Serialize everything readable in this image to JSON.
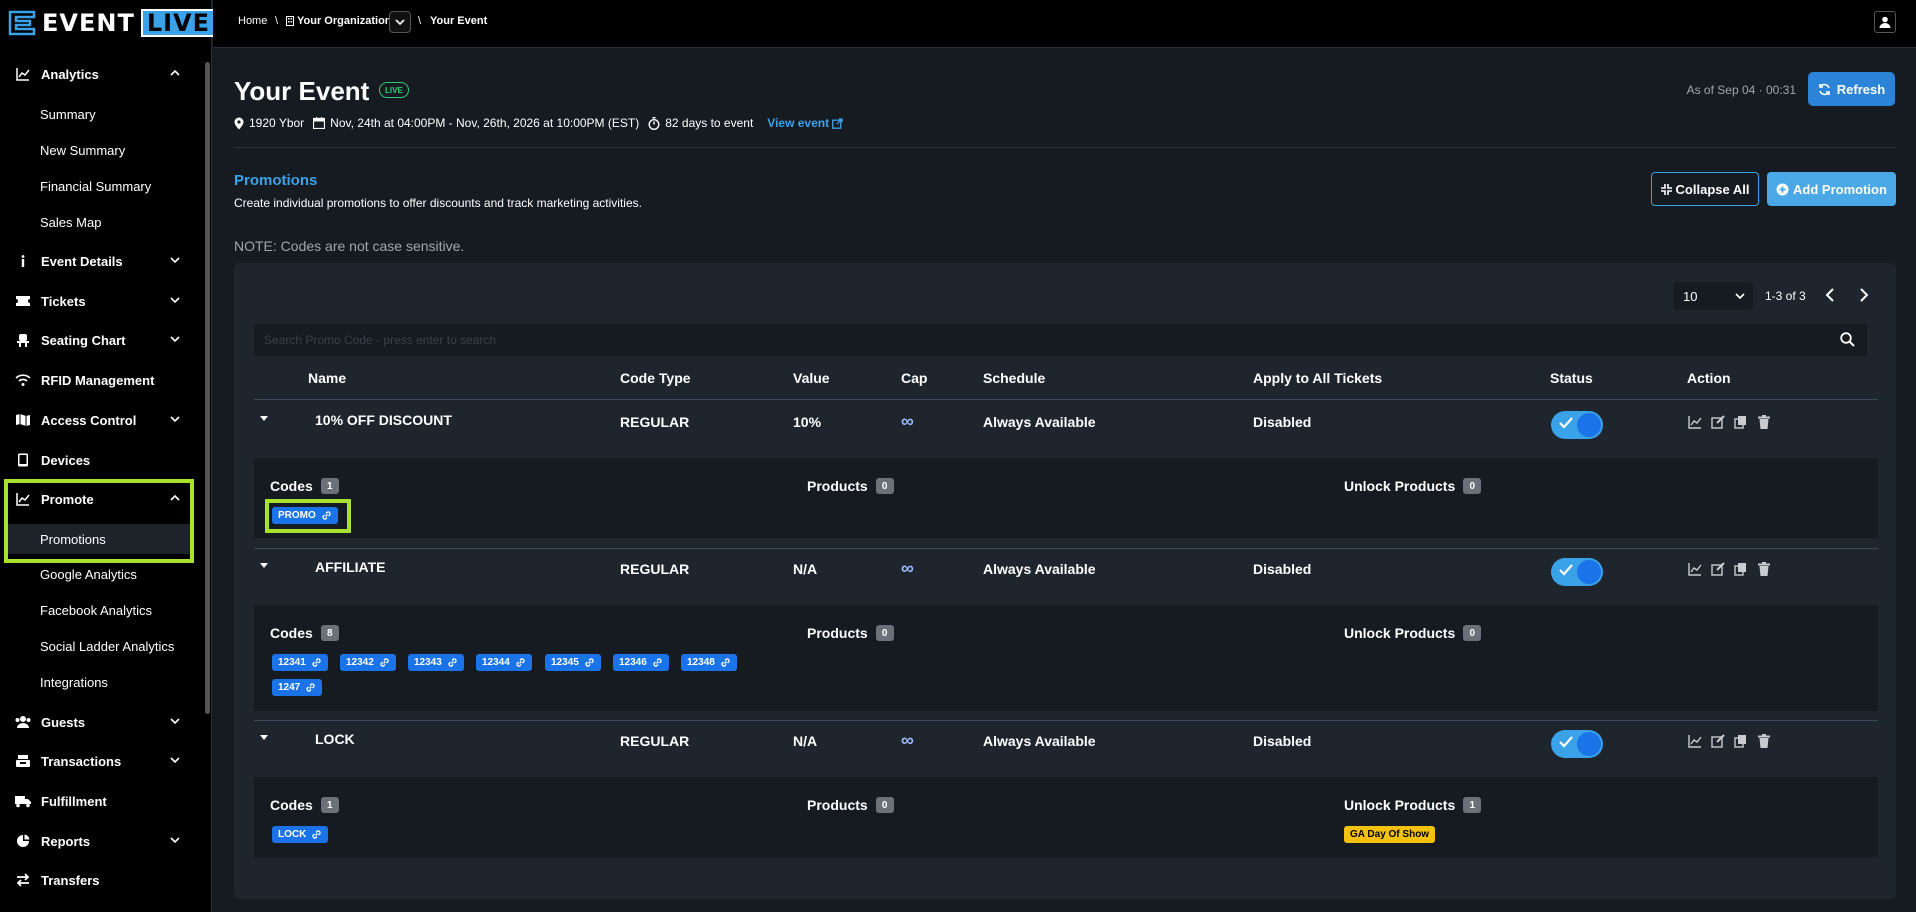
{
  "brand": {
    "event_text": "EVENT",
    "live_text": "LIVE"
  },
  "breadcrumb": {
    "home": "Home",
    "sep": "\\",
    "organization": "Your Organization",
    "event": "Your Event"
  },
  "sidebar": {
    "analytics": "Analytics",
    "summary": "Summary",
    "new_summary": "New Summary",
    "financial_summary": "Financial Summary",
    "sales_map": "Sales Map",
    "event_details": "Event Details",
    "tickets": "Tickets",
    "seating_chart": "Seating Chart",
    "rfid": "RFID Management",
    "access_control": "Access Control",
    "devices": "Devices",
    "promote": "Promote",
    "promotions": "Promotions",
    "google_analytics": "Google Analytics",
    "facebook_analytics": "Facebook Analytics",
    "social_ladder": "Social Ladder Analytics",
    "integrations": "Integrations",
    "guests": "Guests",
    "transactions": "Transactions",
    "fulfillment": "Fulfillment",
    "reports": "Reports",
    "transfers": "Transfers"
  },
  "header": {
    "title": "Your Event",
    "live_badge": "LIVE",
    "as_of": "As of Sep 04 · 00:31",
    "refresh": "Refresh",
    "venue": "1920 Ybor",
    "dates": "Nov, 24th at 04:00PM - Nov, 26th, 2026 at 10:00PM (EST)",
    "countdown": "82 days to event",
    "view_event": "View event"
  },
  "promotions": {
    "title": "Promotions",
    "description": "Create individual promotions to offer discounts and track marketing activities.",
    "collapse_all": "Collapse All",
    "add_promotion": "Add Promotion",
    "note": "NOTE: Codes are not case sensitive."
  },
  "table": {
    "per_page": "10",
    "page_info": "1-3 of 3",
    "search_placeholder": "Search Promo Code - press enter to search",
    "columns": {
      "name": "Name",
      "code_type": "Code Type",
      "value": "Value",
      "cap": "Cap",
      "schedule": "Schedule",
      "apply_all": "Apply to All Tickets",
      "status": "Status",
      "action": "Action"
    },
    "detail_labels": {
      "codes": "Codes",
      "products": "Products",
      "unlock_products": "Unlock Products"
    },
    "rows": [
      {
        "name": "10% OFF DISCOUNT",
        "code_type": "REGULAR",
        "value": "10%",
        "cap": "∞",
        "schedule": "Always Available",
        "apply_all": "Disabled",
        "status_on": true,
        "codes_count": "1",
        "products_count": "0",
        "unlock_count": "0",
        "codes": [
          "PROMO"
        ]
      },
      {
        "name": "AFFILIATE",
        "code_type": "REGULAR",
        "value": "N/A",
        "cap": "∞",
        "schedule": "Always Available",
        "apply_all": "Disabled",
        "status_on": true,
        "codes_count": "8",
        "products_count": "0",
        "unlock_count": "0",
        "codes": [
          "12341",
          "12342",
          "12343",
          "12344",
          "12345",
          "12346",
          "12348",
          "1247"
        ]
      },
      {
        "name": "LOCK",
        "code_type": "REGULAR",
        "value": "N/A",
        "cap": "∞",
        "schedule": "Always Available",
        "apply_all": "Disabled",
        "status_on": true,
        "codes_count": "1",
        "products_count": "0",
        "unlock_count": "1",
        "codes": [
          "LOCK"
        ],
        "unlock_products": [
          "GA Day Of Show"
        ]
      }
    ]
  },
  "colors": {
    "accent": "#3aa2e8",
    "highlight": "#a6e22e",
    "chip": "#1a73e8",
    "product_chip": "#f4c20d"
  }
}
